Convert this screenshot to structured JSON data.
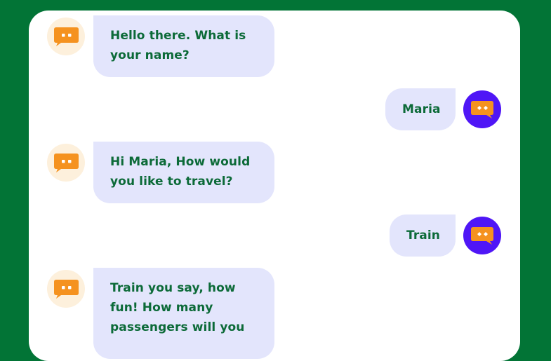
{
  "colors": {
    "background": "#027436",
    "panel": "#ffffff",
    "bubble": "#e3e5fc",
    "text": "#0c6a38",
    "bot_avatar_bg": "#fdf0dc",
    "user_avatar_bg": "#4f16f6",
    "icon_orange": "#f5921f"
  },
  "avatars": {
    "bot_icon": "chat-bubble-icon",
    "user_icon": "chat-bubble-icon"
  },
  "messages": [
    {
      "sender": "bot",
      "text": "Hello there. What is your name?"
    },
    {
      "sender": "user",
      "text": "Maria"
    },
    {
      "sender": "bot",
      "text": "Hi Maria, How would you like to travel?"
    },
    {
      "sender": "user",
      "text": "Train"
    },
    {
      "sender": "bot",
      "text": "Train you say, how fun! How many passengers will you"
    }
  ]
}
